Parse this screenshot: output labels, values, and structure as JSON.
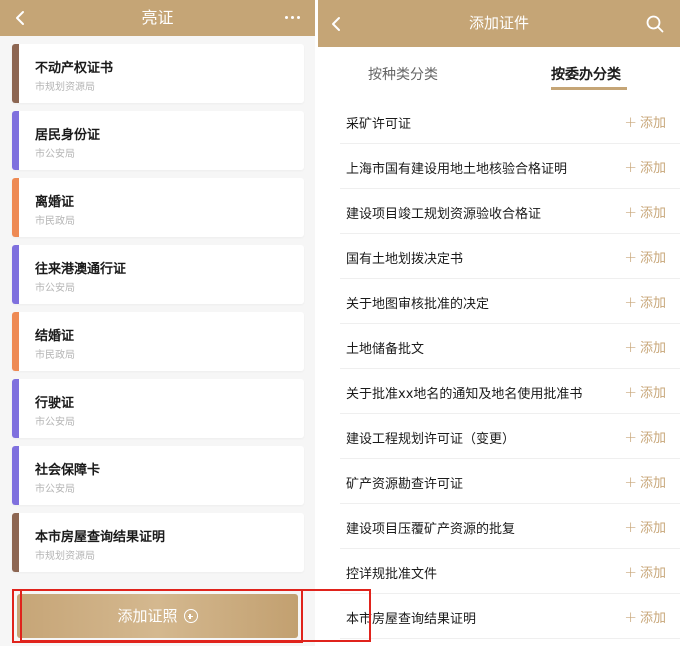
{
  "left": {
    "title": "亮证",
    "cards": [
      {
        "name": "不动产权证书",
        "org": "市规划资源局",
        "color": "#8d6652"
      },
      {
        "name": "居民身份证",
        "org": "市公安局",
        "color": "#7f70de"
      },
      {
        "name": "离婚证",
        "org": "市民政局",
        "color": "#ee8a54"
      },
      {
        "name": "往来港澳通行证",
        "org": "市公安局",
        "color": "#7f70de"
      },
      {
        "name": "结婚证",
        "org": "市民政局",
        "color": "#ee8a54"
      },
      {
        "name": "行驶证",
        "org": "市公安局",
        "color": "#7f70de"
      },
      {
        "name": "社会保障卡",
        "org": "市公安局",
        "color": "#7f70de"
      },
      {
        "name": "本市房屋查询结果证明",
        "org": "市规划资源局",
        "color": "#8d6652"
      }
    ],
    "add_button": "添加证照"
  },
  "right": {
    "title": "添加证件",
    "tabs": [
      "按种类分类",
      "按委办分类"
    ],
    "active_tab": 1,
    "add_label": "添加",
    "items": [
      "采矿许可证",
      "上海市国有建设用地土地核验合格证明",
      "建设项目竣工规划资源验收合格证",
      "国有土地划拨决定书",
      "关于地图审核批准的决定",
      "土地储备批文",
      "关于批准xx地名的通知及地名使用批准书",
      "建设工程规划许可证（变更）",
      "矿产资源勘查许可证",
      "建设项目压覆矿产资源的批复",
      "控详规批准文件",
      "本市房屋查询结果证明"
    ]
  },
  "colors": {
    "accent": "#c5a576",
    "highlight": "#e0231c"
  }
}
